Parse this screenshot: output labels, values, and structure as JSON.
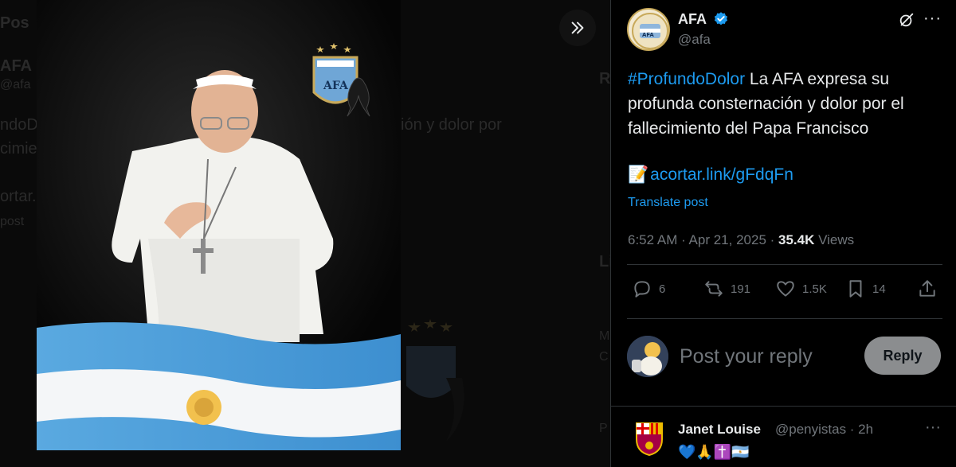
{
  "background": {
    "ghost_top": "Pos",
    "ghost_afa": "AFA",
    "ghost_handle": "@afa",
    "ghost_line1": "ndoD",
    "ghost_line2": "cimie",
    "ghost_line3": "ión y dolor por",
    "ghost_link": "ortar.li",
    "ghost_post": "post",
    "ghost_r1": "Re",
    "ghost_r2": "Li",
    "ghost_r3": "M",
    "ghost_r4": "C",
    "ghost_r5": "P"
  },
  "post": {
    "author_name": "AFA",
    "author_handle": "@afa",
    "hashtag": "#ProfundoDolor",
    "text": " La AFA expresa su profunda consternación y dolor por el fallecimiento del Papa Francisco",
    "link_emoji": "📝",
    "link": "acortar.link/gFdqFn",
    "translate": "Translate post",
    "time": "6:52 AM · Apr 21, 2025 · ",
    "views_count": "35.4K",
    "views_label": " Views",
    "replies": "6",
    "reposts": "191",
    "likes": "1.5K",
    "bookmarks": "14"
  },
  "reply_box": {
    "placeholder": "Post your reply",
    "button": "Reply"
  },
  "comment": {
    "name": "Janet Louise",
    "handle": "@penyistas · 2h",
    "emojis": "💙🙏✝️🇦🇷"
  },
  "icons": {
    "next": "chevrons-right-icon",
    "verified": "verified-badge-icon",
    "grok": "grok-icon",
    "more": "more-icon",
    "reply": "reply-icon",
    "repost": "repost-icon",
    "like": "heart-icon",
    "bookmark": "bookmark-icon",
    "share": "share-icon"
  },
  "colors": {
    "accent": "#1d9bf0",
    "muted": "#71767b",
    "text": "#e7e9ea",
    "border": "#2f3336"
  }
}
